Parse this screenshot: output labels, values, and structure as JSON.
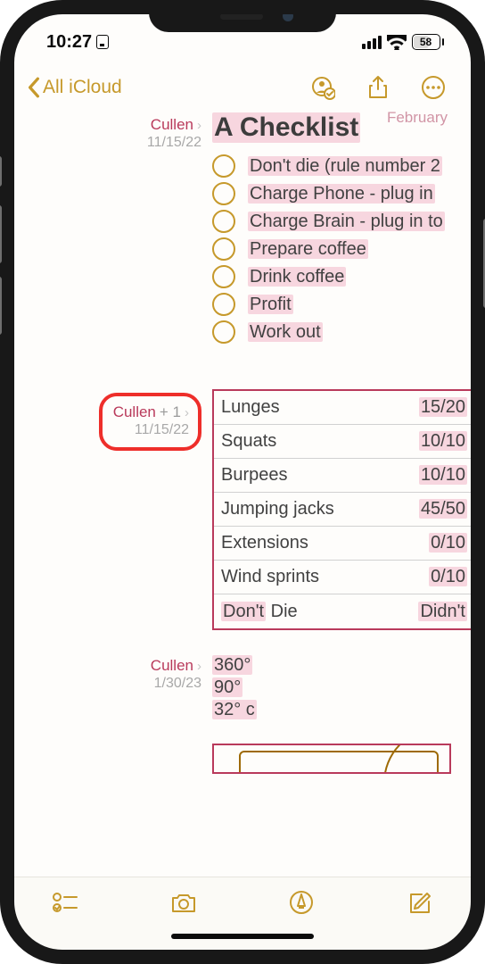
{
  "status": {
    "time": "10:27",
    "battery": "58"
  },
  "nav": {
    "back_label": "All iCloud"
  },
  "activities": [
    {
      "author": "Cullen",
      "date": "11/15/22",
      "title": "A Checklist",
      "items": [
        "Don't die (rule number 2",
        "Charge Phone - plug in ",
        "Charge Brain - plug in to",
        "Prepare coffee",
        "Drink coffee",
        "Profit",
        "Work out"
      ]
    },
    {
      "author": "Cullen",
      "plus": "+ 1",
      "date": "11/15/22",
      "table": [
        {
          "name": "Lunges",
          "val": "15/20"
        },
        {
          "name": "Squats",
          "val": "10/10"
        },
        {
          "name": "Burpees",
          "val": "10/10"
        },
        {
          "name": "Jumping jacks",
          "val": "45/50"
        },
        {
          "name": "Extensions",
          "val": "0/10"
        },
        {
          "name": "Wind sprints",
          "val": "0/10"
        },
        {
          "name_prefix": "Don't",
          "name_rest": " Die",
          "val": "Didn't"
        }
      ]
    },
    {
      "author": "Cullen",
      "date": "1/30/23",
      "lines": [
        "360°",
        "90°",
        "32° c"
      ]
    }
  ],
  "faded_header": "February"
}
